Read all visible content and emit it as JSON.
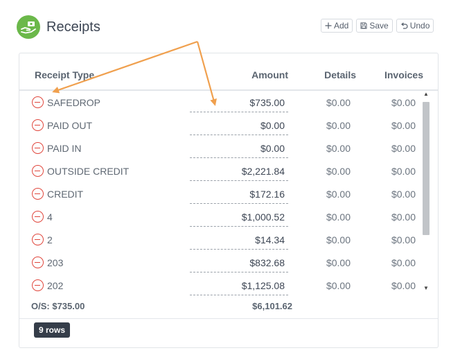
{
  "header": {
    "title": "Receipts",
    "icon": "hand-money-icon"
  },
  "toolbar": {
    "add_label": "Add",
    "save_label": "Save",
    "undo_label": "Undo"
  },
  "table": {
    "columns": {
      "type": "Receipt Type",
      "amount": "Amount",
      "details": "Details",
      "invoices": "Invoices"
    },
    "rows": [
      {
        "name": "SAFEDROP",
        "amount": "$735.00",
        "details": "$0.00",
        "invoices": "$0.00"
      },
      {
        "name": "PAID OUT",
        "amount": "$0.00",
        "details": "$0.00",
        "invoices": "$0.00"
      },
      {
        "name": "PAID IN",
        "amount": "$0.00",
        "details": "$0.00",
        "invoices": "$0.00"
      },
      {
        "name": "OUTSIDE CREDIT",
        "amount": "$2,221.84",
        "details": "$0.00",
        "invoices": "$0.00"
      },
      {
        "name": "CREDIT",
        "amount": "$172.16",
        "details": "$0.00",
        "invoices": "$0.00"
      },
      {
        "name": "4",
        "amount": "$1,000.52",
        "details": "$0.00",
        "invoices": "$0.00"
      },
      {
        "name": "2",
        "amount": "$14.34",
        "details": "$0.00",
        "invoices": "$0.00"
      },
      {
        "name": "203",
        "amount": "$832.68",
        "details": "$0.00",
        "invoices": "$0.00"
      },
      {
        "name": "202",
        "amount": "$1,125.08",
        "details": "$0.00",
        "invoices": "$0.00"
      }
    ]
  },
  "footer": {
    "os_label": "O/S: $735.00",
    "total_amount": "$6,101.62"
  },
  "rows_badge": "9 rows",
  "colors": {
    "logo_green": "#6bb84a",
    "remove_red": "#e0463c",
    "annotation_orange": "#f0a04e",
    "badge_dark": "#353d49"
  }
}
